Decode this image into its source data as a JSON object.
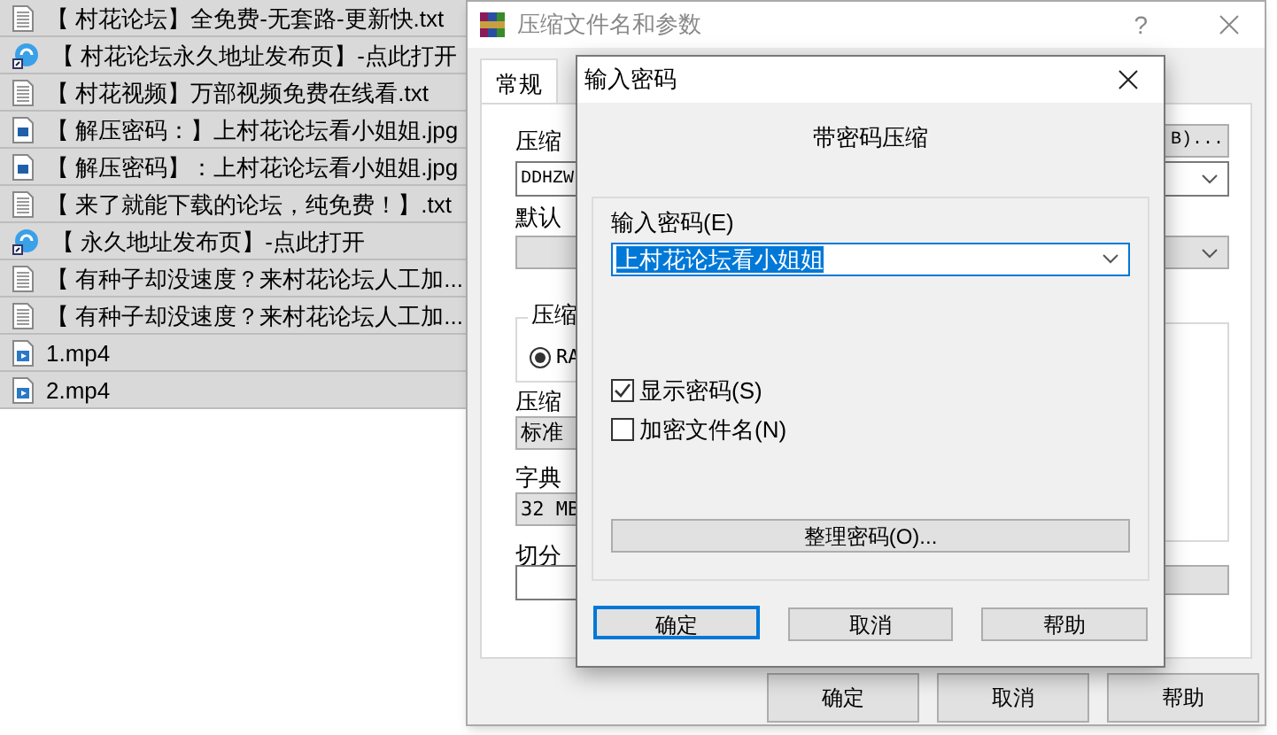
{
  "file_list": [
    {
      "kind": "text",
      "name": "【 村花论坛】全免费-无套路-更新快.txt"
    },
    {
      "kind": "link",
      "name": "【 村花论坛永久地址发布页】-点此打开"
    },
    {
      "kind": "text",
      "name": "【 村花视频】万部视频免费在线看.txt"
    },
    {
      "kind": "image",
      "name": "【 解压密码：】上村花论坛看小姐姐.jpg"
    },
    {
      "kind": "image",
      "name": "【 解压密码】：上村花论坛看小姐姐.jpg"
    },
    {
      "kind": "text",
      "name": "【 来了就能下载的论坛，纯免费！】.txt"
    },
    {
      "kind": "link",
      "name": "【 永久地址发布页】-点此打开"
    },
    {
      "kind": "text",
      "name": "【 有种子却没速度？来村花论坛人工加..."
    },
    {
      "kind": "text",
      "name": "【 有种子却没速度？来村花论坛人工加..."
    },
    {
      "kind": "video",
      "name": "1.mp4"
    },
    {
      "kind": "video",
      "name": "2.mp4"
    }
  ],
  "archive_dialog": {
    "title": "压缩文件名和参数",
    "help": "?",
    "tabs": [
      {
        "label": "常规",
        "selected": true
      }
    ],
    "archive_name_label": "压缩",
    "browse_button": "B)...",
    "archive_name_value": "DDHZW",
    "profiles_label": "默认",
    "format_group_label": "压缩",
    "format_option": {
      "label": "RA",
      "selected": true
    },
    "method_label": "压缩",
    "method_value": "标准",
    "dictionary_label": "字典",
    "dictionary_value": "32 MB",
    "split_label": "切分",
    "buttons": [
      "确定",
      "取消",
      "帮助"
    ]
  },
  "password_dialog": {
    "title": "输入密码",
    "heading": "带密码压缩",
    "password_label": "输入密码(E)",
    "password_value": "上村花论坛看小姐姐",
    "options": [
      {
        "label": "显示密码(S)",
        "checked": true
      },
      {
        "label": "加密文件名(N)",
        "checked": false
      }
    ],
    "organize_button": "整理密码(O)...",
    "buttons": [
      {
        "label": "确定",
        "selected": true
      },
      {
        "label": "取消",
        "selected": false
      },
      {
        "label": "帮助",
        "selected": false
      }
    ]
  }
}
